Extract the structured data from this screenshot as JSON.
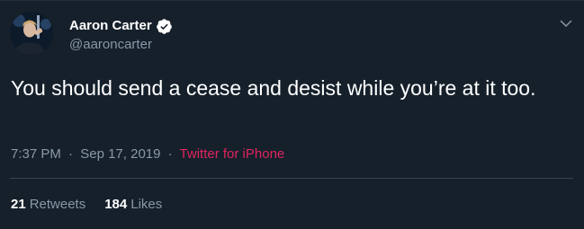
{
  "user": {
    "display_name": "Aaron Carter",
    "handle": "@aaroncarter",
    "verified": true,
    "avatar": "profile-photo"
  },
  "tweet": {
    "text": "You should send a cease and desist while you’re at it too.",
    "time": "7:37 PM",
    "separator_1": "·",
    "date": "Sep 17, 2019",
    "separator_2": "·",
    "source": "Twitter for iPhone"
  },
  "stats": {
    "retweets_count": "21",
    "retweets_label": "Retweets",
    "likes_count": "184",
    "likes_label": "Likes"
  },
  "icons": {
    "verified": "verified-badge-icon",
    "menu": "chevron-down-icon"
  },
  "colors": {
    "background": "#15202b",
    "primary_text": "#ffffff",
    "secondary_text": "#8899a6",
    "source_link": "#e0245e",
    "divider": "#38444d"
  }
}
